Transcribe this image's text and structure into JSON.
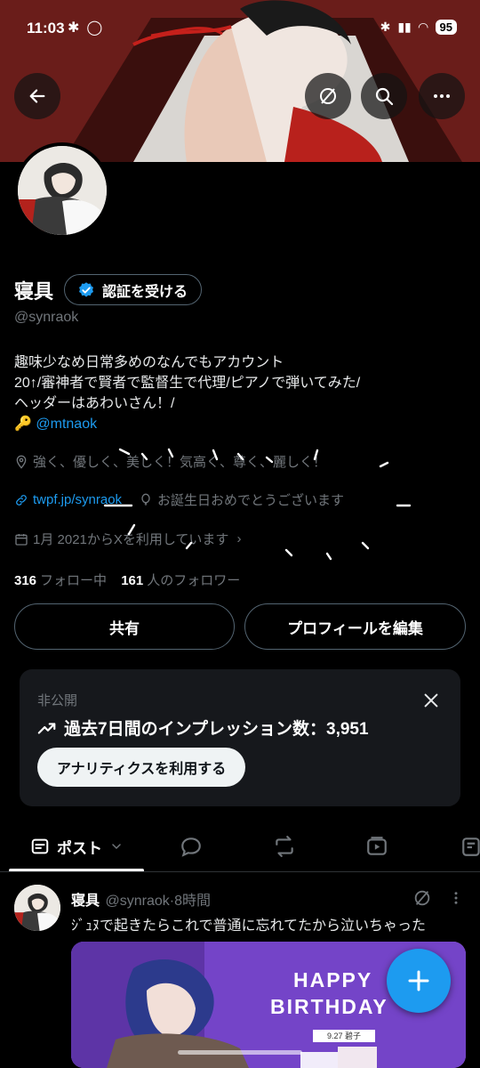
{
  "status_bar": {
    "time": "11:03",
    "battery": "95"
  },
  "profile": {
    "name": "寝具",
    "verify_label": "認証を受ける",
    "handle": "@synraok",
    "bio_lines": [
      "趣味少なめ日常多めのなんでもアカウント",
      "20↑/審神者で賢者で監督生で代理/ピアノで弾いてみた/",
      "ヘッダーはあわいさん！/"
    ],
    "bio_key": "🔑",
    "bio_link": "@mtnaok",
    "location": "強く、優しく、美しく！気高く、尊く、麗しく！",
    "website": "twpf.jp/synraok",
    "birthday": "お誕生日おめでとうございます",
    "joined": "1月 2021からXを利用しています",
    "following_count": "316",
    "following_label": "フォロー中",
    "followers_count": "161",
    "followers_label": "人のフォロワー"
  },
  "actions": {
    "share": "共有",
    "edit": "プロフィールを編集"
  },
  "analytics_card": {
    "label": "非公開",
    "impressions": "過去7日間のインプレッション数：3,951",
    "button": "アナリティクスを利用する"
  },
  "tabs": [
    {
      "label": "ポスト"
    }
  ],
  "post": {
    "name": "寝具",
    "handle": "@synraok",
    "time": "8時間",
    "text": "ｼﾞｭﾇで起きたらこれで普通に忘れてたから泣いちゃった",
    "image": {
      "line1": "HAPPY",
      "line2": "BIRTHDAY",
      "caption": "9.27 碧子"
    }
  },
  "colors": {
    "accent": "#1d9bf0",
    "background": "#000000",
    "card": "#16181c",
    "muted": "#71767b"
  }
}
